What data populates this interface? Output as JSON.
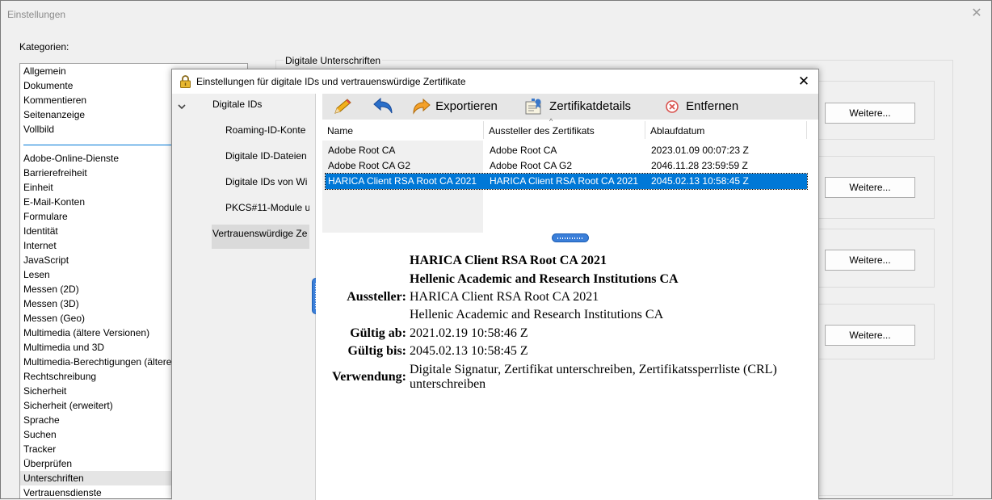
{
  "window": {
    "title": "Einstellungen",
    "close_glyph": "✕"
  },
  "categories": {
    "label": "Kategorien:",
    "group1": [
      "Allgemein",
      "Dokumente",
      "Kommentieren",
      "Seitenanzeige",
      "Vollbild"
    ],
    "group2": [
      "Adobe-Online-Dienste",
      "Barrierefreiheit",
      "Einheit",
      "E-Mail-Konten",
      "Formulare",
      "Identität",
      "Internet",
      "JavaScript",
      "Lesen",
      "Messen (2D)",
      "Messen (3D)",
      "Messen (Geo)",
      "Multimedia (ältere Versionen)",
      "Multimedia und 3D",
      "Multimedia-Berechtigungen (ältere",
      "Rechtschreibung",
      "Sicherheit",
      "Sicherheit (erweitert)",
      "Sprache",
      "Suchen",
      "Tracker",
      "Überprüfen",
      "Unterschriften",
      "Vertrauensdienste"
    ],
    "selected": "Unterschriften"
  },
  "signatures_panel": {
    "title": "Digitale Unterschriften",
    "button_label": "Weitere..."
  },
  "dialog": {
    "title": "Einstellungen für digitale IDs und vertrauenswürdige Zertifikate",
    "close_glyph": "✕",
    "tree": {
      "root": "Digitale IDs",
      "items": [
        "Roaming-ID-Konte",
        "Digitale ID-Dateien",
        "Digitale IDs von Wi",
        "PKCS#11-Module u"
      ],
      "trusted": "Vertrauenswürdige Ze"
    },
    "toolbar": {
      "export_label": "Exportieren",
      "details_label": "Zertifikatdetails",
      "remove_label": "Entfernen"
    },
    "table": {
      "columns": [
        "Name",
        "Aussteller des Zertifikats",
        "Ablaufdatum"
      ],
      "rows": [
        {
          "name": "Adobe Root CA",
          "issuer": "Adobe Root CA",
          "expires": "2023.01.09 00:07:23 Z"
        },
        {
          "name": "Adobe Root CA G2",
          "issuer": "Adobe Root CA G2",
          "expires": "2046.11.28 23:59:59 Z"
        },
        {
          "name": "HARICA Client RSA Root CA 2021",
          "issuer": "HARICA Client RSA Root CA 2021",
          "expires": "2045.02.13 10:58:45 Z"
        }
      ],
      "selected_index": 2
    },
    "details": {
      "subject_line1": "HARICA Client RSA Root CA 2021",
      "subject_line2": "Hellenic Academic and Research Institutions CA",
      "issuer_label": "Aussteller:",
      "issuer_line1": "HARICA Client RSA Root CA 2021",
      "issuer_line2": "Hellenic Academic and Research Institutions CA",
      "valid_from_label": "Gültig ab:",
      "valid_from": "2021.02.19 10:58:46 Z",
      "valid_to_label": "Gültig bis:",
      "valid_to": "2045.02.13 10:58:45 Z",
      "usage_label": "Verwendung:",
      "usage": "Digitale Signatur, Zertifikat unterschreiben, Zertifikatssperrliste (CRL) unterschreiben"
    }
  },
  "colors": {
    "selection": "#0078d7",
    "grip": "#3b7fd9",
    "remove_icon": "#d9534f"
  }
}
